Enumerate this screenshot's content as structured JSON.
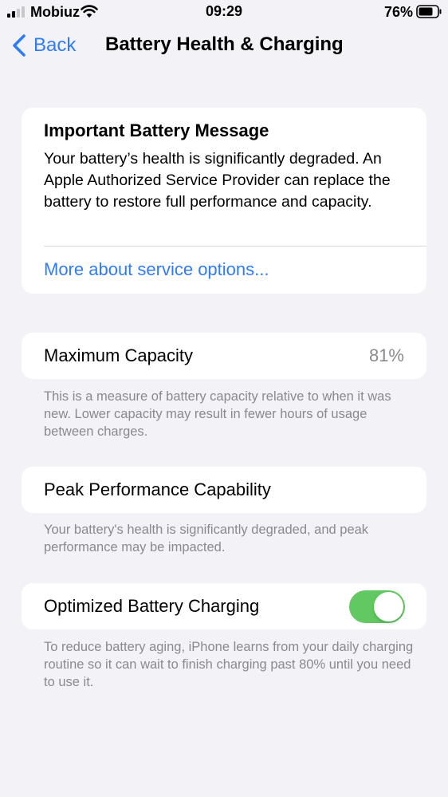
{
  "status_bar": {
    "carrier": "Mobiuz",
    "time": "09:29",
    "battery_percent": "76%",
    "icons": [
      "signal-icon",
      "wifi-icon",
      "battery-icon"
    ]
  },
  "nav": {
    "back_label": "Back",
    "title": "Battery Health & Charging"
  },
  "message": {
    "title": "Important Battery Message",
    "body": "Your battery’s health is significantly degraded. An Apple Authorized Service Provider can replace the battery to restore full performance and capacity.",
    "link": "More about service options..."
  },
  "max_capacity": {
    "label": "Maximum Capacity",
    "value": "81%",
    "footnote": "This is a measure of battery capacity relative to when it was new. Lower capacity may result in fewer hours of usage between charges."
  },
  "peak_performance": {
    "label": "Peak Performance Capability",
    "footnote": "Your battery's health is significantly degraded, and peak performance may be impacted."
  },
  "optimized_charging": {
    "label": "Optimized Battery Charging",
    "enabled": true,
    "footnote": "To reduce battery aging, iPhone learns from your daily charging routine so it can wait to finish charging past 80% until you need to use it."
  },
  "colors": {
    "background": "#f2f2f7",
    "accent": "#2f7cf6",
    "toggle_on": "#62c962",
    "secondary_text": "#8a8a8e"
  }
}
